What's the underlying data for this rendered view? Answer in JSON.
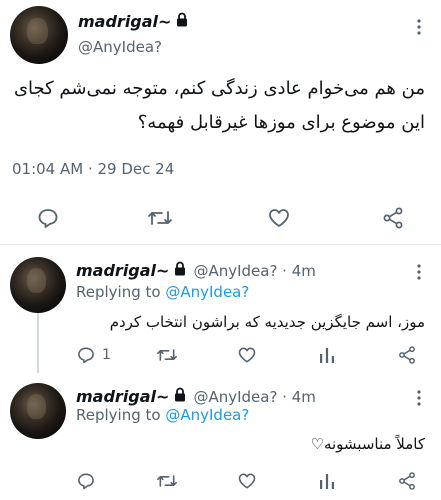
{
  "main_tweet": {
    "display_name": "madrigal~",
    "handle": "@AnyIdea?",
    "text": "من هم می‌خوام عادی زندگی کنم، متوجه نمی‌شم کجای این موضوع برای موزها غیرقابل فهمه؟",
    "timestamp": "01:04 AM · 29 Dec 24",
    "icons": [
      "more-icon",
      "reply-icon",
      "retweet-icon",
      "like-icon",
      "share-icon"
    ]
  },
  "replies": [
    {
      "display_name": "madrigal~",
      "handle_time": "@AnyIdea? · 4m",
      "replying_label": "Replying to",
      "replying_to": "@AnyIdea?",
      "text": "موز، اسم جایگزین جدیدیه که براشون انتخاب کردم",
      "reply_count": "1"
    },
    {
      "display_name": "madrigal~",
      "handle_time": "@AnyIdea? · 4m",
      "replying_label": "Replying to",
      "replying_to": "@AnyIdea?",
      "text": "کاملاً مناسبشونه♡",
      "reply_count": ""
    }
  ],
  "colors": {
    "text": "#0f1419",
    "secondary": "#536471",
    "accent": "#1d9bf0",
    "divider": "#e6ecf0"
  }
}
